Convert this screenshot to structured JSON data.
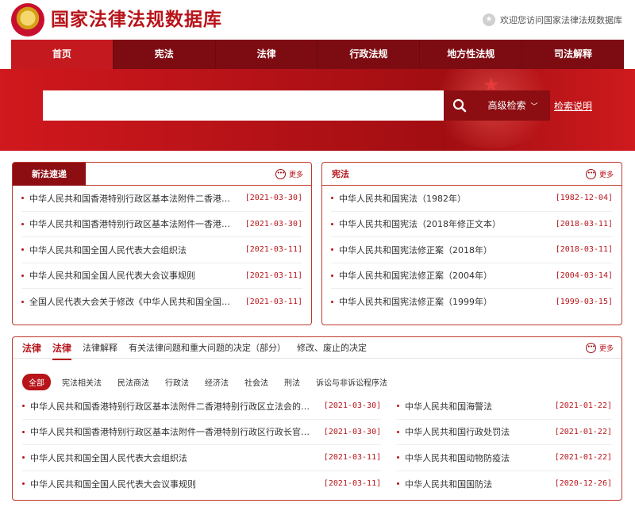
{
  "header": {
    "title": "国家法律法规数据库",
    "welcome": "欢迎您访问国家法律法规数据库"
  },
  "nav": [
    {
      "label": "首页",
      "active": true
    },
    {
      "label": "宪法"
    },
    {
      "label": "法律"
    },
    {
      "label": "行政法规"
    },
    {
      "label": "地方性法规"
    },
    {
      "label": "司法解释"
    }
  ],
  "search": {
    "placeholder": "",
    "advanced_label": "高级检索",
    "help_label": "检索说明"
  },
  "more_label": "更多",
  "new_laws": {
    "title": "新法速递",
    "items": [
      {
        "title": "中华人民共和国香港特别行政区基本法附件二香港特别行政区立法会的产生办法和表决程序",
        "date": "[2021-03-30]"
      },
      {
        "title": "中华人民共和国香港特别行政区基本法附件一香港特别行政区行政长官的产生办法",
        "date": "[2021-03-30]"
      },
      {
        "title": "中华人民共和国全国人民代表大会组织法",
        "date": "[2021-03-11]"
      },
      {
        "title": "中华人民共和国全国人民代表大会议事规则",
        "date": "[2021-03-11]"
      },
      {
        "title": "全国人民代表大会关于修改《中华人民共和国全国人民代表大会组织法》的决定",
        "date": "[2021-03-11]"
      }
    ]
  },
  "constitution": {
    "title": "宪法",
    "items": [
      {
        "title": "中华人民共和国宪法（1982年）",
        "date": "[1982-12-04]"
      },
      {
        "title": "中华人民共和国宪法（2018年修正文本）",
        "date": "[2018-03-11]"
      },
      {
        "title": "中华人民共和国宪法修正案（2018年）",
        "date": "[2018-03-11]"
      },
      {
        "title": "中华人民共和国宪法修正案（2004年）",
        "date": "[2004-03-14]"
      },
      {
        "title": "中华人民共和国宪法修正案（1999年）",
        "date": "[1999-03-15]"
      }
    ]
  },
  "laws": {
    "section_title": "法律",
    "tabs": [
      "法律",
      "法律解释",
      "有关法律问题和重大问题的决定（部分）",
      "修改、废止的决定"
    ],
    "chips": [
      "全部",
      "宪法相关法",
      "民法商法",
      "行政法",
      "经济法",
      "社会法",
      "刑法",
      "诉讼与非诉讼程序法"
    ],
    "left": [
      {
        "title": "中华人民共和国香港特别行政区基本法附件二香港特别行政区立法会的产生办法",
        "date": "[2021-03-30]"
      },
      {
        "title": "中华人民共和国香港特别行政区基本法附件一香港特别行政区行政长官的产生办法",
        "date": "[2021-03-30]"
      },
      {
        "title": "中华人民共和国全国人民代表大会组织法",
        "date": "[2021-03-11]"
      },
      {
        "title": "中华人民共和国全国人民代表大会议事规则",
        "date": "[2021-03-11]"
      }
    ],
    "right": [
      {
        "title": "中华人民共和国海警法",
        "date": "[2021-01-22]"
      },
      {
        "title": "中华人民共和国行政处罚法",
        "date": "[2021-01-22]"
      },
      {
        "title": "中华人民共和国动物防疫法",
        "date": "[2021-01-22]"
      },
      {
        "title": "中华人民共和国国防法",
        "date": "[2020-12-26]"
      }
    ]
  }
}
